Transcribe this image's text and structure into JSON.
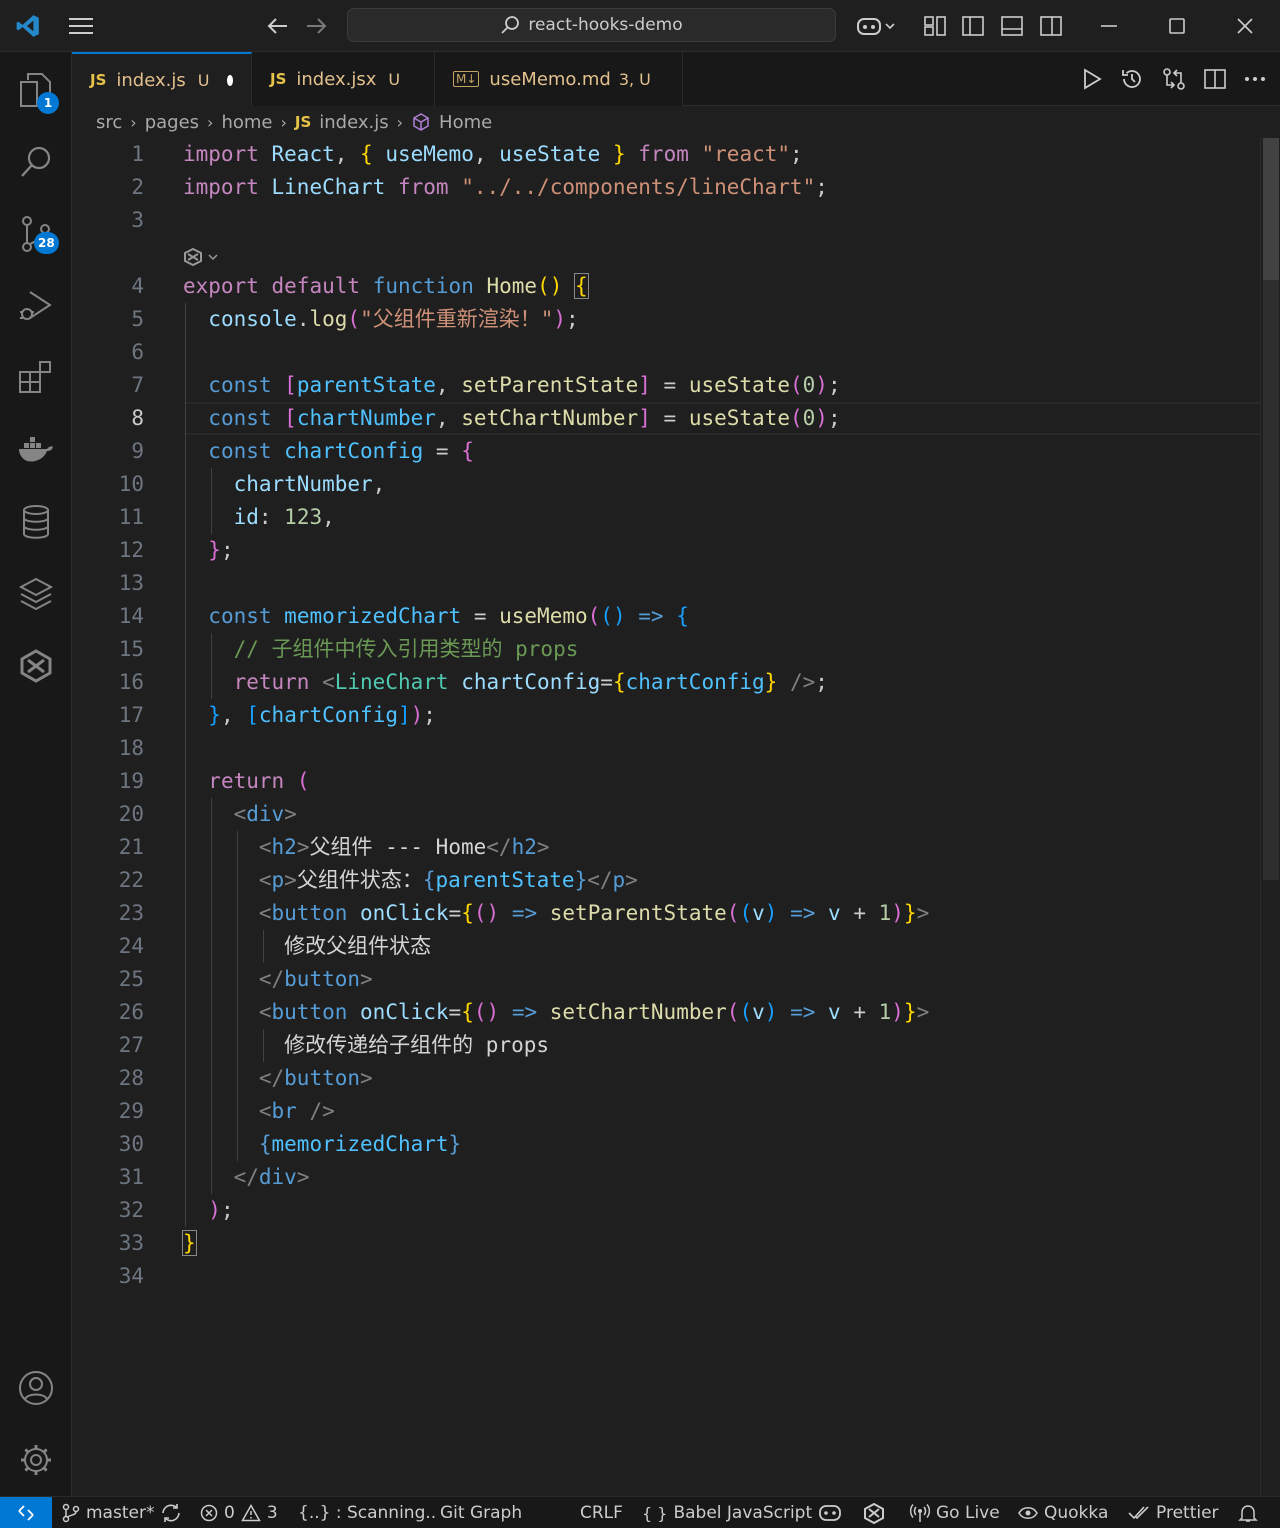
{
  "window": {
    "search_text": "react-hooks-demo",
    "accent": "#0078d4"
  },
  "activity": {
    "explorer_badge": "1",
    "scm_badge": "28"
  },
  "tabs": [
    {
      "name": "index.js",
      "lang": "JS",
      "flag": "U",
      "modified": true
    },
    {
      "name": "index.jsx",
      "lang": "JS",
      "flag": "U"
    },
    {
      "name": "useMemo.md",
      "lang": "M↓",
      "flag": "3, U"
    }
  ],
  "breadcrumb": {
    "parts": [
      "src",
      "pages",
      "home",
      "index.js",
      "Home"
    ],
    "file_lang": "JS"
  },
  "editor": {
    "current_line": 8,
    "line_numbers": [
      "1",
      "2",
      "3",
      "4",
      "5",
      "6",
      "7",
      "8",
      "9",
      "10",
      "11",
      "12",
      "13",
      "14",
      "15",
      "16",
      "17",
      "18",
      "19",
      "20",
      "21",
      "22",
      "23",
      "24",
      "25",
      "26",
      "27",
      "28",
      "29",
      "30",
      "31",
      "32",
      "33",
      "34"
    ],
    "code": {
      "l1": {
        "import": "import",
        "react": "React",
        "usememo": "useMemo",
        "usestate": "useState",
        "from": "from",
        "mod": "\"react\""
      },
      "l2": {
        "import": "import",
        "linechart": "LineChart",
        "from": "from",
        "mod": "\"../../components/lineChart\""
      },
      "l4": {
        "export": "export",
        "default": "default",
        "function": "function",
        "name": "Home"
      },
      "l5": {
        "console": "console",
        "log": "log",
        "str": "\"父组件重新渲染！\""
      },
      "l7": {
        "const": "const",
        "a": "parentState",
        "b": "setParentState",
        "fn": "useState",
        "num": "0"
      },
      "l8": {
        "const": "const",
        "a": "chartNumber",
        "b": "setChartNumber",
        "fn": "useState",
        "num": "0"
      },
      "l9": {
        "const": "const",
        "name": "chartConfig"
      },
      "l10": {
        "prop": "chartNumber"
      },
      "l11": {
        "prop": "id",
        "num": "123"
      },
      "l14": {
        "const": "const",
        "name": "memorizedChart",
        "fn": "useMemo"
      },
      "l15": {
        "comment": "// 子组件中传入引用类型的 props"
      },
      "l16": {
        "return": "return",
        "comp": "LineChart",
        "attr": "chartConfig",
        "val": "chartConfig"
      },
      "l17": {
        "dep": "chartConfig"
      },
      "l19": {
        "return": "return"
      },
      "l20": {
        "tag": "div"
      },
      "l21": {
        "tag": "h2",
        "text": "父组件 --- Home"
      },
      "l22": {
        "tag": "p",
        "text": "父组件状态：",
        "var": "parentState"
      },
      "l23": {
        "tag": "button",
        "attr": "onClick",
        "fn": "setParentState",
        "v": "v",
        "num": "1"
      },
      "l24": {
        "text": "修改父组件状态"
      },
      "l25": {
        "tag": "button"
      },
      "l26": {
        "tag": "button",
        "attr": "onClick",
        "fn": "setChartNumber",
        "v": "v",
        "num": "1"
      },
      "l27": {
        "text": "修改传递给子组件的 props"
      },
      "l28": {
        "tag": "button"
      },
      "l29": {
        "tag": "br"
      },
      "l30": {
        "var": "memorizedChart"
      },
      "l31": {
        "tag": "div"
      }
    }
  },
  "statusbar": {
    "branch": "master*",
    "errors": "0",
    "warnings": "3",
    "scanning": "{..} : Scanning..",
    "git_graph": "Git Graph",
    "eol": "CRLF",
    "language": "Babel JavaScript",
    "go_live": "Go Live",
    "quokka": "Quokka",
    "prettier": "Prettier"
  }
}
